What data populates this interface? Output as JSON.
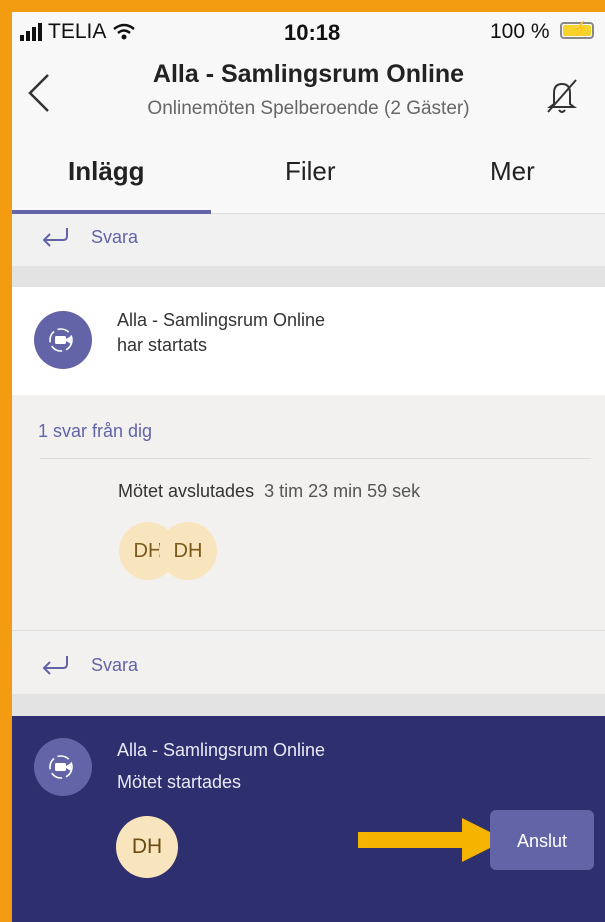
{
  "status": {
    "carrier": "TELIA",
    "time": "10:18",
    "battery": "100 %"
  },
  "header": {
    "title": "Alla - Samlingsrum Online",
    "subtitle": "Onlinemöten Spelberoende (2 Gäster)"
  },
  "tabs": [
    {
      "label": "Inlägg",
      "active": true
    },
    {
      "label": "Filer",
      "active": false
    },
    {
      "label": "Mer",
      "active": false
    }
  ],
  "reply_label": "Svara",
  "message1": {
    "line1": "Alla - Samlingsrum Online",
    "line2": "har startats"
  },
  "thread": {
    "reply_count": "1 svar från dig",
    "ended_text": "Mötet avslutades",
    "duration": "3 tim 23 min 59 sek",
    "participants": [
      "DH",
      "DH"
    ]
  },
  "message2": {
    "line1": "Alla - Samlingsrum Online",
    "line2": "Mötet startades",
    "participant": "DH",
    "join_label": "Anslut"
  },
  "colors": {
    "accent": "#6264a7",
    "dark_card": "#2e2f6e",
    "highlight_arrow": "#f5b400",
    "frame": "#f39c12"
  }
}
